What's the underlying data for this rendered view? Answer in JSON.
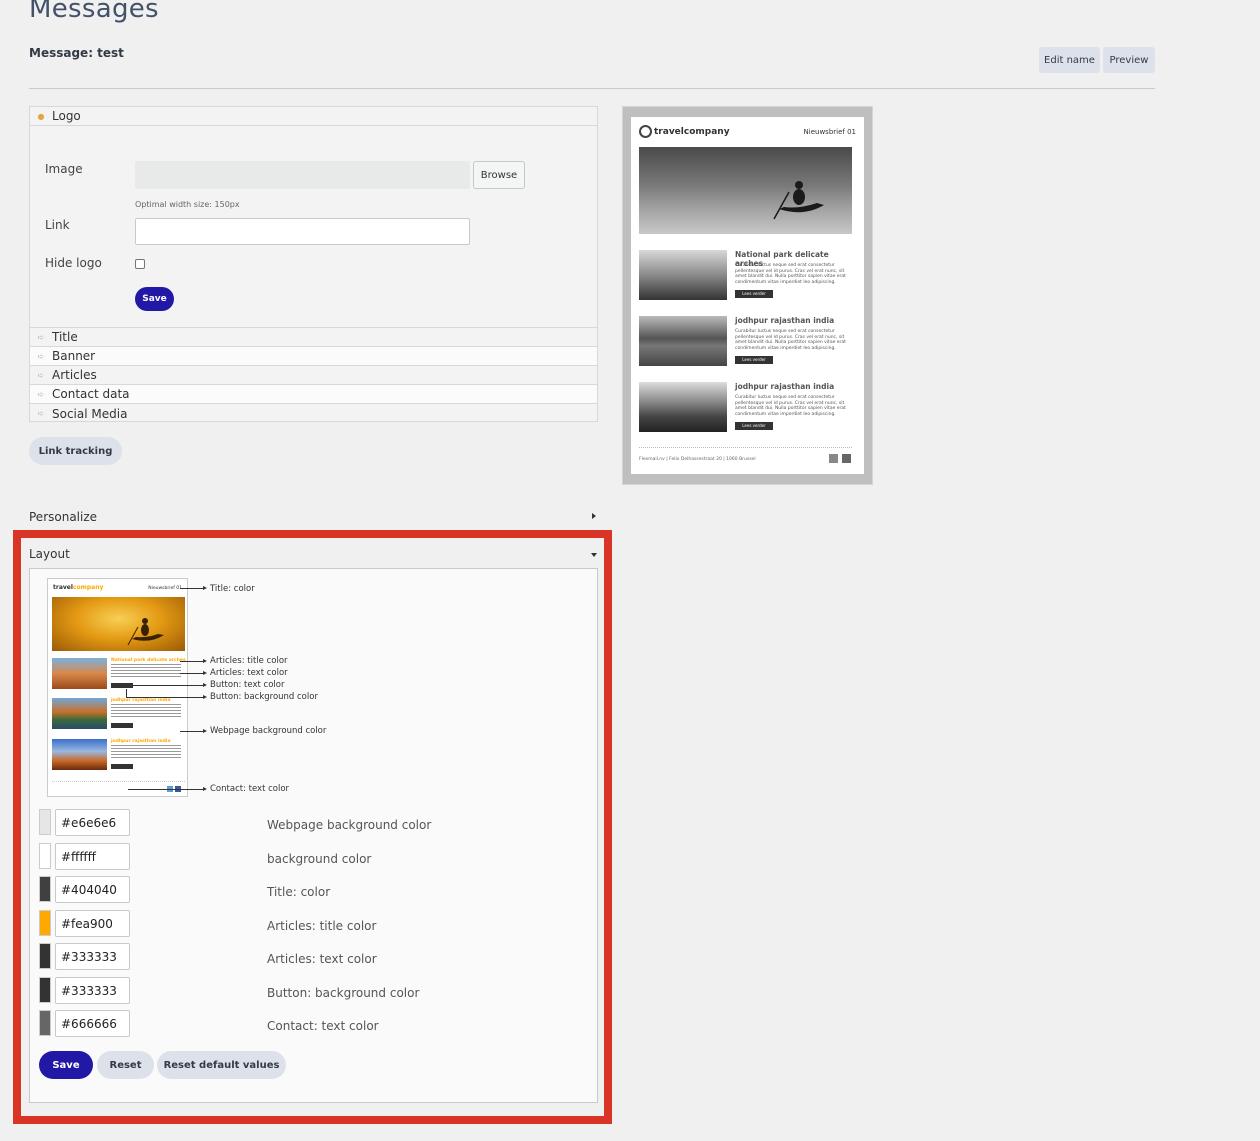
{
  "page": {
    "title": "Messages",
    "message_name": "Message: test"
  },
  "toolbar": {
    "edit_name": "Edit name",
    "preview": "Preview"
  },
  "accordion": {
    "logo": {
      "header": "Logo",
      "image_label": "Image",
      "browse": "Browse",
      "hint": "Optimal width size: 150px",
      "link_label": "Link",
      "link_value": "",
      "hide_label": "Hide logo",
      "save": "Save"
    },
    "items": [
      "Title",
      "Banner",
      "Articles",
      "Contact data",
      "Social Media"
    ]
  },
  "link_tracking": "Link tracking",
  "preview": {
    "brand": "travelcompany",
    "newsletter": "Nieuwsbrief 01",
    "articles": [
      {
        "title": "National park delicate arches",
        "text": "Curabitur luctus neque sed erat consectetur pellentesque vel id purus. Cras vel erat nunc, sit amet blandit dui. Nulla porttitor sapien vitae erat condimentum vitae imperdiet leo adipiscing.",
        "button": "Lees verder"
      },
      {
        "title": "jodhpur rajasthan india",
        "text": "Curabitur luctus neque sed erat consectetur pellentesque vel id purus. Cras vel erat nunc, sit amet blandit dui. Nulla porttitor sapien vitae erat condimentum vitae imperdiet leo adipiscing.",
        "button": "Lees verder"
      },
      {
        "title": "jodhpur rajasthan india",
        "text": "Curabitur luctus neque sed erat consectetur pellentesque vel id purus. Cras vel erat nunc, sit amet blandit dui. Nulla porttitor sapien vitae erat condimentum vitae imperdiet leo adipiscing.",
        "button": "Lees verder"
      }
    ],
    "footer": "Flexmail.nv  |  Felix Delhassestraat 20  |  1060 Brussel"
  },
  "personalize": {
    "label": "Personalize"
  },
  "layout": {
    "label": "Layout",
    "mini": {
      "brand_a": "travel",
      "brand_b": "company",
      "newsletter": "Nieuwsbrief 01",
      "article_titles": [
        "National park delicate arches",
        "jodhpur rajasthan india",
        "jodhpur rajasthan india"
      ]
    },
    "annotations": [
      "Title: color",
      "Articles: title color",
      "Articles: text color",
      "Button: text color",
      "Button: background color",
      "Webpage background color",
      "Contact: text color"
    ],
    "colors": [
      {
        "value": "#e6e6e6",
        "label": "Webpage background color",
        "swatch": "#e6e6e6"
      },
      {
        "value": "#ffffff",
        "label": "background color",
        "swatch": "#ffffff"
      },
      {
        "value": "#404040",
        "label": "Title: color",
        "swatch": "#404040"
      },
      {
        "value": "#fea900",
        "label": "Articles: title color",
        "swatch": "#fea900"
      },
      {
        "value": "#333333",
        "label": "Articles: text color",
        "swatch": "#333333"
      },
      {
        "value": "#333333",
        "label": "Button: background color",
        "swatch": "#333333"
      },
      {
        "value": "#666666",
        "label": "Contact: text color",
        "swatch": "#666666"
      }
    ],
    "buttons": {
      "save": "Save",
      "reset": "Reset",
      "reset_default": "Reset default values"
    }
  },
  "theme": {
    "primary": "#2218a6",
    "secondary": "#dde2ea",
    "highlight": "#d93526"
  }
}
